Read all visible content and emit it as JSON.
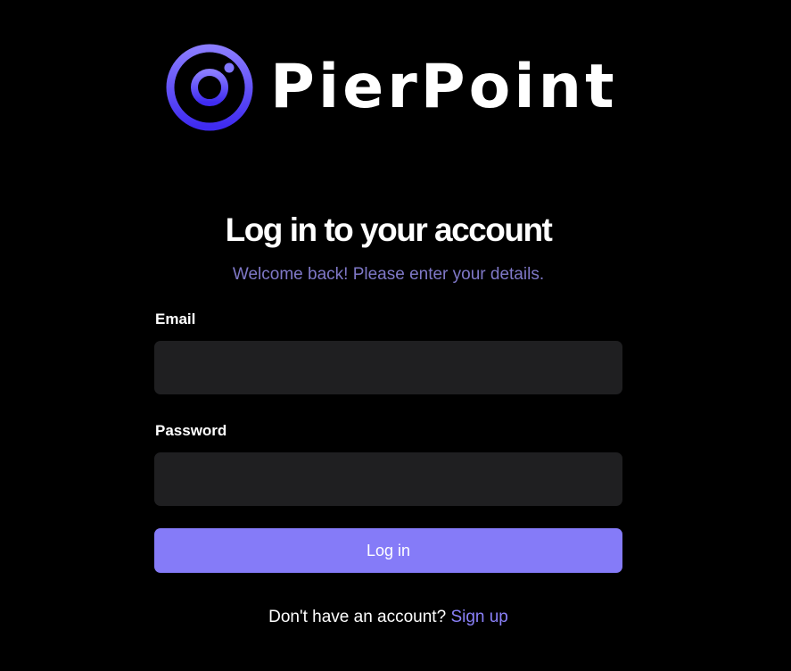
{
  "brand": {
    "name": "PierPoint",
    "logo_icon": "ring-camera-icon",
    "logo_gradient": [
      "#8a7cff",
      "#3f2bf0"
    ]
  },
  "form": {
    "title": "Log in to your account",
    "subtitle": "Welcome back! Please enter your details.",
    "email": {
      "label": "Email",
      "value": "",
      "placeholder": ""
    },
    "password": {
      "label": "Password",
      "value": "",
      "placeholder": ""
    },
    "submit_label": "Log in"
  },
  "footer": {
    "prompt": "Don't have an account?",
    "link_label": "Sign up"
  },
  "colors": {
    "background": "#000000",
    "accent": "#857bf8",
    "input_bg": "#1f1f21",
    "subtitle": "#7f78c7"
  }
}
